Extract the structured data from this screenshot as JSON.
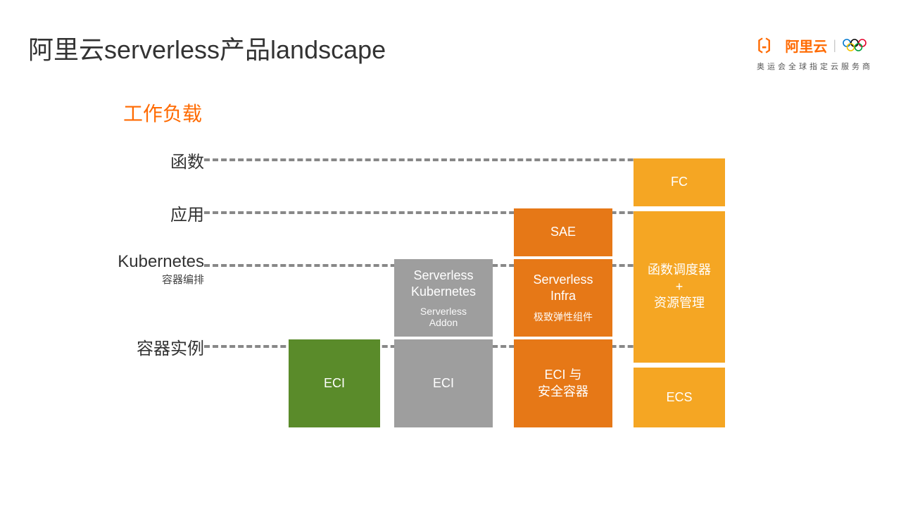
{
  "title": "阿里云serverless产品landscape",
  "brand": {
    "name": "阿里云",
    "sub": "奥运会全球指定云服务商"
  },
  "workload_label": "工作负载",
  "rows": {
    "r1": {
      "label": "函数"
    },
    "r2": {
      "label": "应用"
    },
    "r3": {
      "label": "Kubernetes",
      "sub": "容器编排"
    },
    "r4": {
      "label": "容器实例"
    }
  },
  "boxes": {
    "eci_green": "ECI",
    "eci_grey": "ECI",
    "sk_main": "Serverless\nKubernetes",
    "sk_sub": "Serverless\nAddon",
    "sae": "SAE",
    "si_main": "Serverless\nInfra",
    "si_sub": "极致弹性组件",
    "eci_sec": "ECI 与\n安全容器",
    "fc": "FC",
    "mid": "函数调度器\n+\n资源管理",
    "ecs": "ECS"
  },
  "chart_data": {
    "type": "table",
    "title": "阿里云serverless产品landscape",
    "row_axis": "工作负载 (workload layers, top→bottom)",
    "rows": [
      "函数",
      "应用",
      "Kubernetes 容器编排",
      "容器实例"
    ],
    "columns": [
      "ECI (standalone)",
      "Serverless Kubernetes",
      "SAE",
      "FC"
    ],
    "cells": [
      [
        "",
        "",
        "",
        "FC"
      ],
      [
        "",
        "",
        "SAE",
        "函数调度器 + 资源管理"
      ],
      [
        "",
        "Serverless Kubernetes / Serverless Addon",
        "Serverless Infra / 极致弹性组件",
        "函数调度器 + 资源管理"
      ],
      [
        "ECI",
        "ECI",
        "ECI 与 安全容器",
        "ECS"
      ]
    ],
    "column_colors": [
      "#5a8b2a",
      "#9e9e9e",
      "#e67817",
      "#f5a623"
    ]
  }
}
